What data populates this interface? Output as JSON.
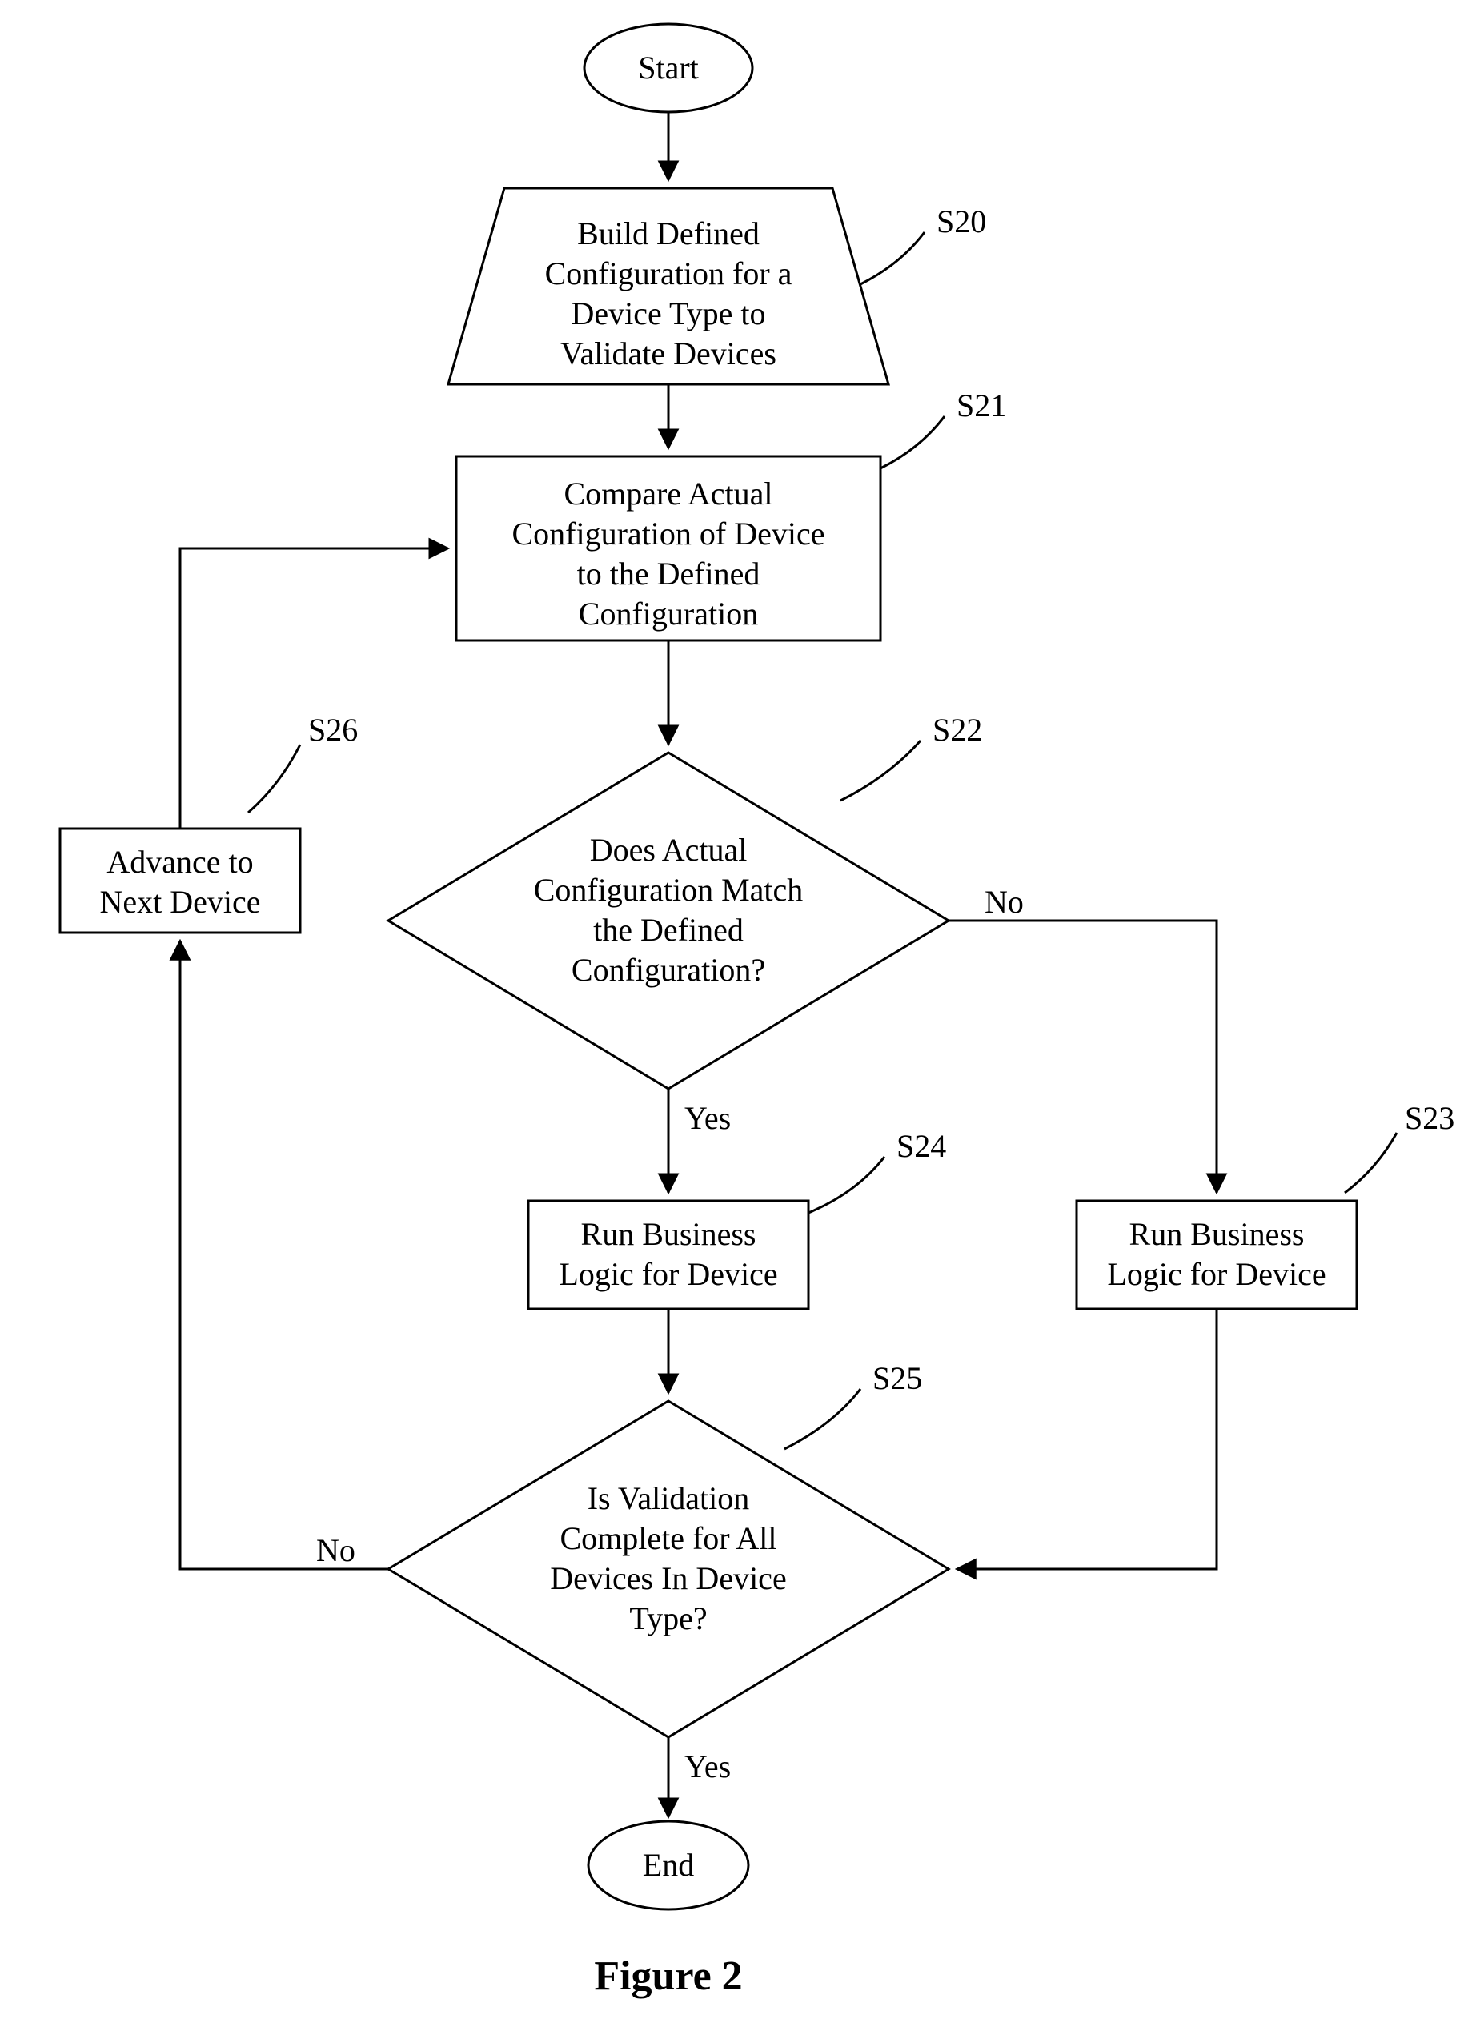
{
  "caption": "Figure 2",
  "nodes": {
    "start": {
      "text": "Start"
    },
    "s20": {
      "label": "S20",
      "lines": [
        "Build Defined",
        "Configuration for a",
        "Device Type to",
        "Validate Devices"
      ]
    },
    "s21": {
      "label": "S21",
      "lines": [
        "Compare Actual",
        "Configuration of Device",
        "to the Defined",
        "Configuration"
      ]
    },
    "s22": {
      "label": "S22",
      "lines": [
        "Does Actual",
        "Configuration Match",
        "the Defined",
        "Configuration?"
      ]
    },
    "s23": {
      "label": "S23",
      "lines": [
        "Run Business",
        "Logic for Device"
      ]
    },
    "s24": {
      "label": "S24",
      "lines": [
        "Run Business",
        "Logic for Device"
      ]
    },
    "s25": {
      "label": "S25",
      "lines": [
        "Is Validation",
        "Complete for All",
        "Devices In Device",
        "Type?"
      ]
    },
    "s26": {
      "label": "S26",
      "lines": [
        "Advance to",
        "Next Device"
      ]
    },
    "end": {
      "text": "End"
    }
  },
  "edges": {
    "s22_yes": "Yes",
    "s22_no": "No",
    "s25_yes": "Yes",
    "s25_no": "No"
  }
}
